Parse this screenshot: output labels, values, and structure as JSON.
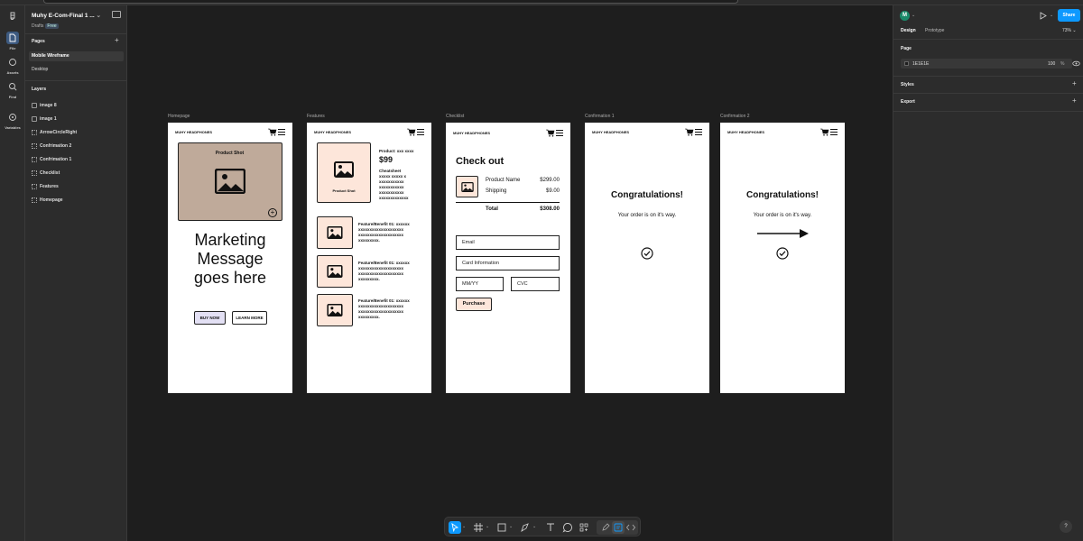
{
  "file": {
    "title": "Muhy E-Com-Final 1 ...",
    "location": "Drafts",
    "plan": "Free"
  },
  "rail": {
    "file": "File",
    "assets": "Assets",
    "find": "Find",
    "variables": "Variables"
  },
  "pages": {
    "heading": "Pages",
    "items": [
      "Mobile Wireframe",
      "Desktop"
    ]
  },
  "layers": {
    "heading": "Layers",
    "items": [
      "image 8",
      "image 1",
      "ArrowCircleRight",
      "Confrimation 2",
      "Confrimation 1",
      "Checklist",
      "Features",
      "Homepage"
    ]
  },
  "right": {
    "avatar": "M",
    "share": "Share",
    "tabs": [
      "Design",
      "Prototype"
    ],
    "zoom": "73%",
    "page_heading": "Page",
    "bg_hex": "1E1E1E",
    "bg_opacity": "100",
    "bg_unit": "%",
    "styles": "Styles",
    "export": "Export"
  },
  "frames": {
    "homepage": {
      "label": "Homepage",
      "brand": "MUHY HEADPHONES",
      "shot": "Product Shot",
      "line1": "Marketing",
      "line2": "Message",
      "line3": "goes here",
      "buy": "BUY NOW",
      "learn": "LEARN MORE"
    },
    "features": {
      "label": "Features",
      "brand": "MUHY HEADPHONES",
      "shot": "Product Shot",
      "product": "Product: xxx xxxx",
      "price": "$99",
      "cheat_title": "Cheatsheet",
      "cheat_lines": [
        "xxxxx xxxxx x",
        "xxxxxxxxxxx",
        "xxxxxxxxxxx",
        "xxxxxxxxxxx",
        "xxxxxxxxxxxxx"
      ],
      "benefits": [
        {
          "title": "Feature/Benefit 01:",
          "lines": [
            "xxxxxx",
            "xxxxxxxxxxxxxxxxxxxx",
            "xxxxxxxxxxxxxxxxxxxx",
            "xxxxxxxxx."
          ]
        },
        {
          "title": "Feature/Benefit 01:",
          "lines": [
            "xxxxxx",
            "xxxxxxxxxxxxxxxxxxxx",
            "xxxxxxxxxxxxxxxxxxxx",
            "xxxxxxxxx."
          ]
        },
        {
          "title": "Feature/Benefit 01:",
          "lines": [
            "xxxxxx",
            "xxxxxxxxxxxxxxxxxxxx",
            "xxxxxxxxxxxxxxxxxxxx",
            "xxxxxxxxx."
          ]
        }
      ]
    },
    "checkout": {
      "label": "Checklist",
      "brand": "MUHY HEADPHONES",
      "title": "Check out",
      "item_name": "Product Name",
      "item_price": "$299.00",
      "ship_name": "Shipping",
      "ship_price": "$9.00",
      "total_name": "Total",
      "total_price": "$308.00",
      "email": "Email",
      "card": "Card Information",
      "mmyy": "MM/YY",
      "cvc": "CVC",
      "purchase": "Purchase"
    },
    "confirm1": {
      "label": "Confirmation 1",
      "brand": "MUHY HEADPHONES",
      "title": "Congratulations!",
      "msg": "Your order is on it's way."
    },
    "confirm2": {
      "label": "Confirmation 2",
      "brand": "MUHY HEADPHONES",
      "title": "Congratulations!",
      "msg": "Your order is on it's way."
    }
  },
  "help": "?"
}
